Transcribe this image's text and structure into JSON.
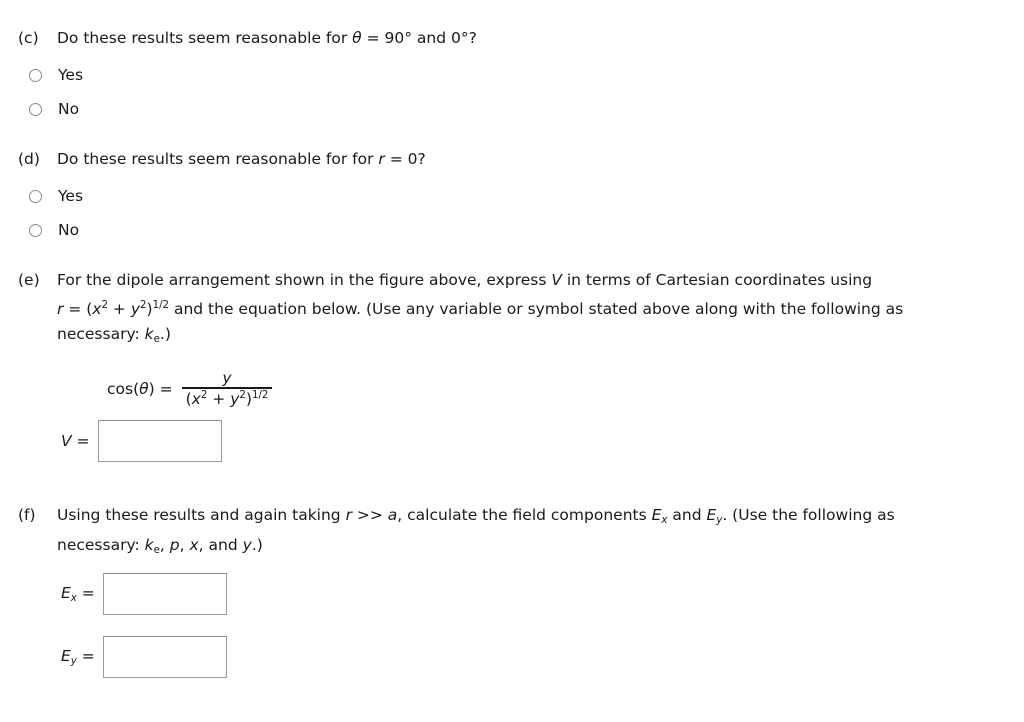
{
  "page": {
    "background_color": "#ffffff",
    "text_color": "#1a1a1a",
    "input_border_color": "#9a9a9a",
    "radio_border_color": "#8c8c8c"
  },
  "questions": [
    {
      "label": "(c)",
      "prompt_prefix": "Do these results seem reasonable for ",
      "prompt_var": "θ",
      "prompt_suffix": " = 90° and 0°?",
      "full_prompt": "Do these results seem reasonable for θ = 90° and 0°?",
      "choices": [
        {
          "value": "yes",
          "label": "Yes",
          "selected": false
        },
        {
          "value": "no",
          "label": "No",
          "selected": false
        }
      ]
    },
    {
      "label": "(d)",
      "prompt_prefix": "Do these results seem reasonable for for ",
      "prompt_var": "r",
      "prompt_suffix": " = 0?",
      "full_prompt": "Do these results seem reasonable for for r = 0?",
      "choices": [
        {
          "value": "yes",
          "label": "Yes",
          "selected": false
        },
        {
          "value": "no",
          "label": "No",
          "selected": false
        }
      ]
    }
  ],
  "part_e": {
    "label": "(e)",
    "line1_a": "For the dipole arrangement shown in the figure above, express ",
    "line1_var": "V",
    "line1_b": " in terms of Cartesian coordinates using",
    "line2_r": "r",
    "line2_eq": " = (",
    "line2_x": "x",
    "line2_x_exp": "2",
    "line2_plus": " + ",
    "line2_y": "y",
    "line2_y_exp": "2",
    "line2_close": ")",
    "line2_pow": "1/2",
    "line2_rest": " and the equation below. (Use any variable or symbol stated above along with the following as",
    "line3_a": "necessary: ",
    "line3_k": "k",
    "line3_k_sub": "e",
    "line3_b": ".)",
    "equation": {
      "lhs": "cos(θ)  =",
      "lhs_fn": "cos(",
      "lhs_theta": "θ",
      "lhs_close": ")  =",
      "numerator": "y",
      "denominator_open": "(",
      "denominator_x": "x",
      "denominator_x_exp": "2",
      "denominator_plus": " + ",
      "denominator_y": "y",
      "denominator_y_exp": "2",
      "denominator_close": ")",
      "denominator_pow": "1/2"
    },
    "answer": {
      "label_var": "V",
      "label_eq": " =",
      "value": "",
      "placeholder": ""
    }
  },
  "part_f": {
    "label": "(f)",
    "line1_a": "Using these results and again taking ",
    "line1_r": "r",
    "line1_gt": " >> ",
    "line1_a_sym": "a",
    "line1_b": ", calculate the field components ",
    "line1_Ex": "E",
    "line1_Ex_sub": "x",
    "line1_and": " and ",
    "line1_Ey": "E",
    "line1_Ey_sub": "y",
    "line1_c": ". (Use the following as",
    "line2_a": "necessary: ",
    "line2_k": "k",
    "line2_k_sub": "e",
    "line2_b": ", ",
    "line2_p": "p",
    "line2_c": ", ",
    "line2_x": "x",
    "line2_d": ", and ",
    "line2_y": "y",
    "line2_e": ".)",
    "answers": [
      {
        "label_var": "E",
        "label_sub": "x",
        "label_eq": " =",
        "value": "",
        "placeholder": ""
      },
      {
        "label_var": "E",
        "label_sub": "y",
        "label_eq": " =",
        "value": "",
        "placeholder": ""
      }
    ]
  }
}
